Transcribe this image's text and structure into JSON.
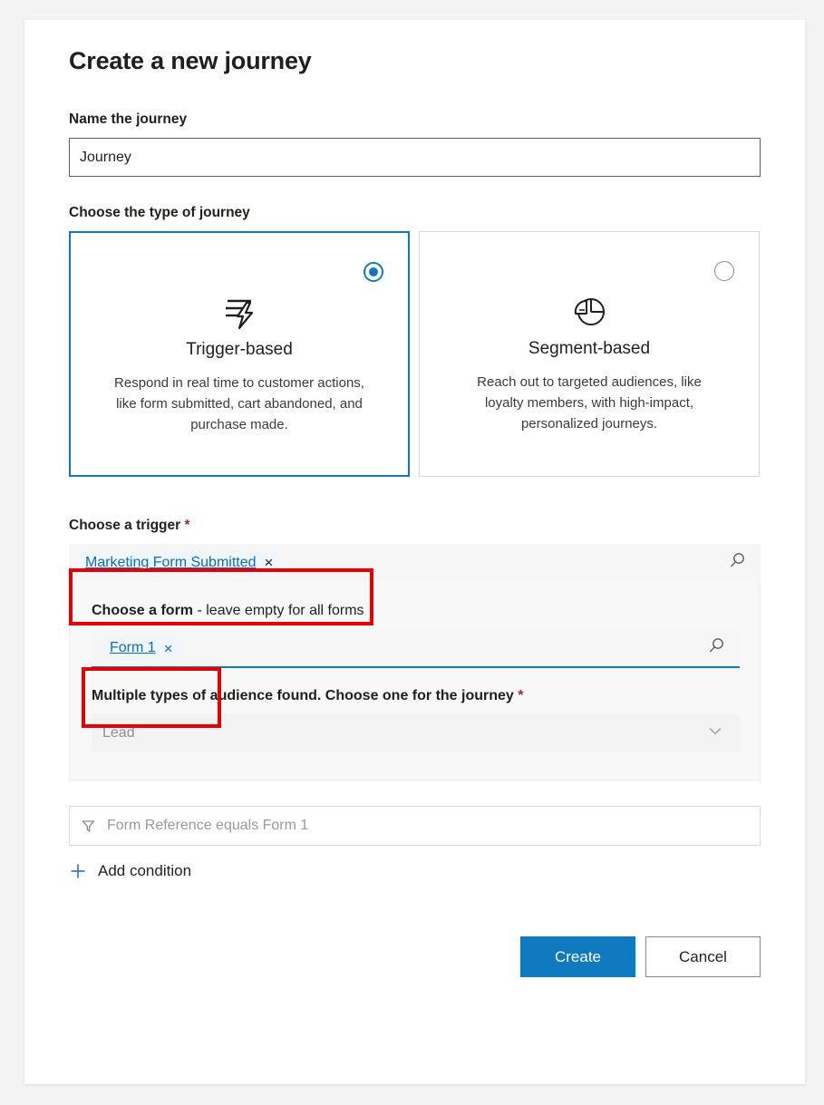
{
  "dialog": {
    "title": "Create a new journey",
    "name_field": {
      "label": "Name the journey",
      "value": "Journey",
      "placeholder": "Journey"
    },
    "type_section": {
      "label": "Choose the type of journey",
      "cards": [
        {
          "title": "Trigger-based",
          "description": "Respond in real time to customer actions, like form submitted, cart abandoned, and purchase made.",
          "icon": "lightning-lines-icon",
          "selected": true
        },
        {
          "title": "Segment-based",
          "description": "Reach out to targeted audiences, like loyalty members, with high-impact, personalized journeys.",
          "icon": "pie-chart-icon",
          "selected": false
        }
      ]
    },
    "trigger_section": {
      "label": "Choose a trigger",
      "required_mark": "*",
      "selected_trigger": "Marketing Form Submitted",
      "remove_label": "×",
      "search_icon": "search-icon",
      "form_subsection": {
        "label_bold": "Choose a form",
        "label_rest": " - leave empty for all forms",
        "selected_form": "Form 1",
        "remove_label": "×",
        "search_icon": "search-icon"
      },
      "audience": {
        "label": "Multiple types of audience found. Choose one for the journey",
        "required_mark": "*",
        "value": "Lead",
        "chevron_icon": "chevron-down-icon"
      }
    },
    "condition_section": {
      "filter_icon": "funnel-icon",
      "condition_text": "Form Reference equals Form 1",
      "add_icon": "plus-icon",
      "add_label": "Add condition"
    },
    "footer": {
      "primary_label": "Create",
      "secondary_label": "Cancel"
    }
  },
  "colors": {
    "accent": "#0f7ac0",
    "link": "#0f6cbd",
    "required": "#a4262c",
    "annotation": "#e60000",
    "panel": "#f8f8f8",
    "pill": "#eff6fc"
  },
  "annotations": [
    {
      "name": "trigger-highlight",
      "target": "Marketing Form Submitted"
    },
    {
      "name": "form-highlight",
      "target": "Form 1"
    }
  ]
}
